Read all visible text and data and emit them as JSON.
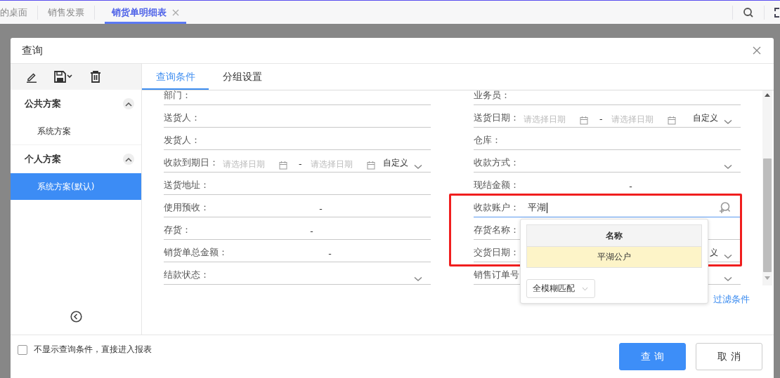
{
  "top_tabs": [
    {
      "label": "的桌面",
      "selected": false,
      "closable": false
    },
    {
      "label": "销售发票",
      "selected": false,
      "closable": false
    },
    {
      "label": "销货单明细表",
      "selected": true,
      "closable": true
    }
  ],
  "dialog": {
    "title": "查询"
  },
  "sidebar": {
    "groups": [
      {
        "title": "公共方案",
        "expanded": true,
        "items": [
          {
            "label": "系统方案",
            "selected": false
          }
        ]
      },
      {
        "title": "个人方案",
        "expanded": true,
        "items": [
          {
            "label": "系统方案(默认)",
            "selected": true
          }
        ]
      }
    ]
  },
  "tabs": [
    {
      "label": "查询条件",
      "selected": true
    },
    {
      "label": "分组设置",
      "selected": false
    }
  ],
  "fields_left": [
    {
      "kind": "text",
      "label": "部门："
    },
    {
      "kind": "text",
      "label": "送货人："
    },
    {
      "kind": "text",
      "label": "发货人："
    },
    {
      "kind": "date_range",
      "label": "收款到期日：",
      "from_placeholder": "请选择日期",
      "separator": "-",
      "to_placeholder": "请选择日期",
      "mode": "自定义"
    },
    {
      "kind": "text",
      "label": "送货地址："
    },
    {
      "kind": "range",
      "label": "使用预收：",
      "separator": "-"
    },
    {
      "kind": "range",
      "label": "存货：",
      "separator": "-"
    },
    {
      "kind": "range",
      "label": "销货单总金额：",
      "separator": "-"
    },
    {
      "kind": "select",
      "label": "结款状态："
    }
  ],
  "fields_right": [
    {
      "kind": "text",
      "label": "业务员："
    },
    {
      "kind": "date_range",
      "label": "送货日期：",
      "from_placeholder": "请选择日期",
      "separator": "-",
      "to_placeholder": "请选择日期",
      "mode": "自定义"
    },
    {
      "kind": "text",
      "label": "仓库："
    },
    {
      "kind": "select",
      "label": "收款方式："
    },
    {
      "kind": "range",
      "label": "现结金额：",
      "separator": "-"
    },
    {
      "kind": "lookup",
      "label": "收款账户：",
      "value": "平湖",
      "focused": true
    },
    {
      "kind": "text",
      "label": "存货名称："
    },
    {
      "kind": "tail",
      "label": "交货日期：",
      "tail": "义"
    },
    {
      "kind": "select",
      "label": "销售订单号"
    }
  ],
  "filter_link": "过滤条件",
  "popup": {
    "column": "名称",
    "rows": [
      {
        "label": "平湖公户",
        "selected": true
      }
    ],
    "match_mode": "全模糊匹配"
  },
  "footer": {
    "checkbox": {
      "label": "不显示查询条件，直接进入报表",
      "checked": false
    },
    "buttons": [
      {
        "label": "查 询",
        "kind": "primary"
      },
      {
        "label": "取 消",
        "kind": "default"
      }
    ]
  }
}
